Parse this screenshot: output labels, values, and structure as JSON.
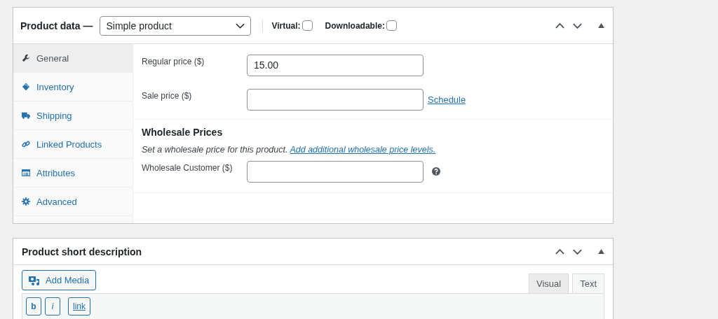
{
  "product_data": {
    "title": "Product data —",
    "product_type": {
      "value": "Simple product"
    },
    "options": [
      {
        "label": "Virtual:",
        "checked": false
      },
      {
        "label": "Downloadable:",
        "checked": false
      }
    ],
    "tabs": [
      {
        "label": "General",
        "selected": true
      },
      {
        "label": "Inventory",
        "selected": false
      },
      {
        "label": "Shipping",
        "selected": false
      },
      {
        "label": "Linked Products",
        "selected": false
      },
      {
        "label": "Attributes",
        "selected": false
      },
      {
        "label": "Advanced",
        "selected": false
      }
    ],
    "price_fields": [
      {
        "label": "Regular price ($)",
        "value": "15.00"
      },
      {
        "label": "Sale price ($)",
        "link": "Schedule"
      }
    ],
    "wholesale": {
      "heading": "Wholesale Prices",
      "description": "Set a wholesale price for this product.",
      "link": "Add additional wholesale price levels.",
      "field": {
        "label": "Wholesale Customer ($)"
      }
    }
  },
  "short_description": {
    "title": "Product short description",
    "add_media": "Add Media",
    "editor_tabs": [
      {
        "label": "Visual",
        "selected": false
      },
      {
        "label": "Text",
        "selected": true
      }
    ],
    "quicktags": [
      {
        "label": "b",
        "kind": "bold"
      },
      {
        "label": "i",
        "kind": "italic"
      },
      {
        "label": "link",
        "kind": "link"
      }
    ]
  }
}
